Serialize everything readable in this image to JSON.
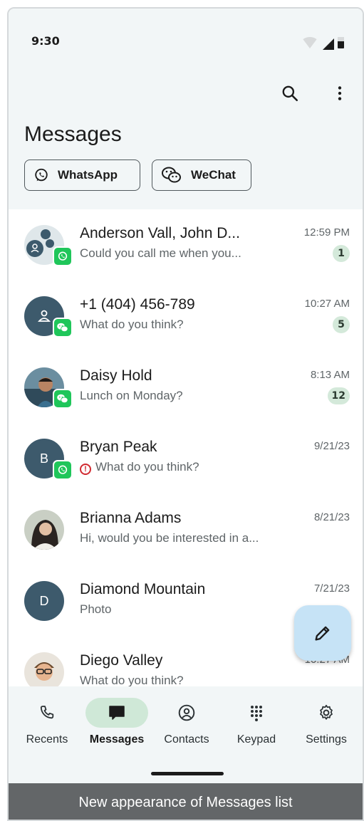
{
  "status_bar": {
    "time": "9:30"
  },
  "header": {
    "title": "Messages"
  },
  "filters": [
    {
      "label": "WhatsApp",
      "icon": "whatsapp-icon"
    },
    {
      "label": "WeChat",
      "icon": "wechat-icon"
    }
  ],
  "conversations": [
    {
      "name": "Anderson Vall, John D...",
      "preview": "Could you call me when you...",
      "time": "12:59 PM",
      "unread": "1",
      "app": "whatsapp",
      "avatar": "group"
    },
    {
      "name": "+1 (404) 456-789",
      "preview": "What do you think?",
      "time": "10:27 AM",
      "unread": "5",
      "app": "wechat",
      "avatar": "person-icon"
    },
    {
      "name": "Daisy Hold",
      "preview": "Lunch on Monday?",
      "time": "8:13 AM",
      "unread": "12",
      "app": "wechat",
      "avatar": "photo"
    },
    {
      "name": "Bryan Peak",
      "preview": "What do you think?",
      "time": "9/21/23",
      "unread": "",
      "app": "whatsapp",
      "avatar_initial": "B",
      "error": true
    },
    {
      "name": "Brianna Adams",
      "preview": "Hi, would you be interested in a...",
      "time": "8/21/23",
      "unread": "",
      "avatar": "photo"
    },
    {
      "name": "Diamond Mountain",
      "preview": "Photo",
      "time": "7/21/23",
      "unread": "",
      "avatar_initial": "D"
    },
    {
      "name": "Diego Valley",
      "preview": "What do you think?",
      "time": "10:27 AM",
      "unread": "",
      "avatar": "photo"
    }
  ],
  "nav": [
    {
      "label": "Recents",
      "icon": "phone-icon",
      "active": false
    },
    {
      "label": "Messages",
      "icon": "chat-icon",
      "active": true
    },
    {
      "label": "Contacts",
      "icon": "contact-icon",
      "active": false
    },
    {
      "label": "Keypad",
      "icon": "keypad-icon",
      "active": false
    },
    {
      "label": "Settings",
      "icon": "gear-icon",
      "active": false
    }
  ],
  "caption": "New appearance of Messages list",
  "colors": {
    "whatsapp_green": "#1fc65a",
    "avatar_blue": "#3d5a6c",
    "fab_bg": "#c6e3f6",
    "nav_active": "#cfe8d7",
    "badge_bg": "#d4e9da"
  }
}
